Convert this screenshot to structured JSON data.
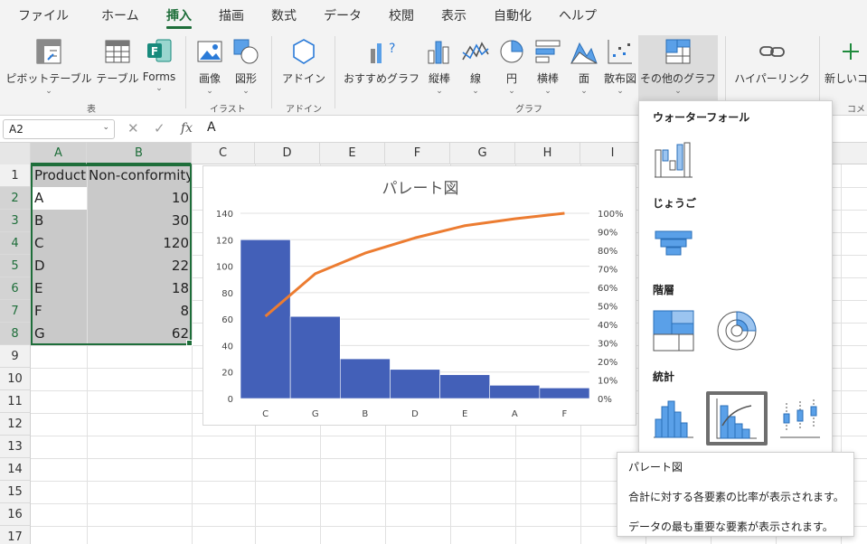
{
  "menu": {
    "tabs": [
      "ファイル",
      "ホーム",
      "挿入",
      "描画",
      "数式",
      "データ",
      "校閲",
      "表示",
      "自動化",
      "ヘルプ"
    ],
    "active_tab": "挿入"
  },
  "ribbon": {
    "pivot": "ピボットテーブル",
    "table": "テーブル",
    "forms": "Forms",
    "image": "画像",
    "shapes": "図形",
    "addin": "アドイン",
    "recommended_charts": "おすすめグラフ",
    "bar": "縦棒",
    "line": "線",
    "pie": "円",
    "hbar": "横棒",
    "area": "面",
    "scatter": "散布図",
    "other_charts": "その他のグラフ",
    "hyperlink": "ハイパーリンク",
    "new_comment": "新しいコ",
    "groups": {
      "table": "表",
      "illustration": "イラスト",
      "addin": "アドイン",
      "chart": "グラフ",
      "comment": "コメ"
    }
  },
  "formula_bar": {
    "name_box": "A2",
    "value": "A",
    "fx": "fx"
  },
  "columns": [
    "A",
    "B",
    "C",
    "D",
    "E",
    "F",
    "G",
    "H",
    "I"
  ],
  "rows": [
    "1",
    "2",
    "3",
    "4",
    "5",
    "6",
    "7",
    "8",
    "9",
    "10",
    "11",
    "12",
    "13",
    "14",
    "15",
    "16",
    "17"
  ],
  "sheet": {
    "headers": [
      "Product",
      "Non-conformity"
    ],
    "data": [
      {
        "product": "A",
        "value": "10"
      },
      {
        "product": "B",
        "value": "30"
      },
      {
        "product": "C",
        "value": "120"
      },
      {
        "product": "D",
        "value": "22"
      },
      {
        "product": "E",
        "value": "18"
      },
      {
        "product": "F",
        "value": "8"
      },
      {
        "product": "G",
        "value": "62"
      }
    ]
  },
  "chart_data": {
    "type": "bar",
    "title": "パレート図",
    "categories": [
      "C",
      "G",
      "B",
      "D",
      "E",
      "A",
      "F"
    ],
    "series": [
      {
        "name": "",
        "type": "bar",
        "values": [
          120,
          62,
          30,
          22,
          18,
          10,
          8
        ]
      },
      {
        "name": "",
        "type": "line",
        "axis": "secondary",
        "values": [
          44.4,
          67.4,
          78.5,
          86.7,
          93.3,
          97.0,
          100.0
        ]
      }
    ],
    "ylim": [
      0,
      140
    ],
    "yticks": [
      "0",
      "20",
      "40",
      "60",
      "80",
      "100",
      "120",
      "140"
    ],
    "y2lim": [
      0,
      100
    ],
    "y2ticks": [
      "0%",
      "10%",
      "20%",
      "30%",
      "40%",
      "50%",
      "60%",
      "70%",
      "80%",
      "90%",
      "100%"
    ],
    "grid": true,
    "colors": {
      "bar": "#4360b8",
      "line": "#ec7c31"
    }
  },
  "dropdown": {
    "waterfall": "ウォーターフォール",
    "funnel": "じょうご",
    "hierarchy": "階層",
    "statistics": "統計"
  },
  "tooltip": {
    "title": "パレート図",
    "line1": "合計に対する各要素の比率が表示されます。",
    "line2": "データの最も重要な要素が表示されます。"
  }
}
